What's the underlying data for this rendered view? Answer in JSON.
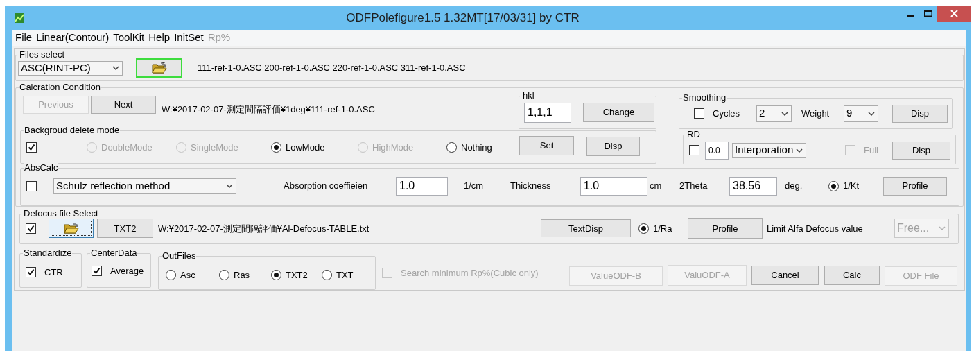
{
  "window": {
    "title": "ODFPolefigure1.5 1.32MT[17/03/31] by CTR"
  },
  "menu": [
    {
      "label": "File",
      "disabled": false
    },
    {
      "label": "Linear(Contour)",
      "disabled": false
    },
    {
      "label": "ToolKit",
      "disabled": false
    },
    {
      "label": "Help",
      "disabled": false
    },
    {
      "label": "InitSet",
      "disabled": false
    },
    {
      "label": "Rp%",
      "disabled": true
    }
  ],
  "files_select": {
    "title": "Files select",
    "items": [
      {
        "kind": "combo",
        "value": "ASC(RINT-PC)",
        "disabled": false
      },
      {
        "kind": "folder_button",
        "highlighted": true,
        "focused": false
      },
      {
        "kind": "text",
        "text": "111-ref-1-0.ASC 200-ref-1-0.ASC 220-ref-1-0.ASC 311-ref-1-0.ASC"
      }
    ]
  },
  "calc_condition": {
    "title": "Calcration Condition",
    "items": [
      {
        "kind": "button",
        "label": "Previous",
        "disabled": true
      },
      {
        "kind": "button",
        "label": "Next",
        "disabled": false
      },
      {
        "kind": "text",
        "text": "W:¥2017-02-07-測定間隔評価¥1deg¥111-ref-1-0.ASC"
      }
    ],
    "hkl": {
      "title": "hkl",
      "items": [
        {
          "kind": "field",
          "value": "1,1,1"
        },
        {
          "kind": "button",
          "label": "Change",
          "disabled": false
        }
      ]
    },
    "smoothing": {
      "title": "Smoothing",
      "items": [
        {
          "kind": "checkbox",
          "label": "Cycles",
          "checked": false,
          "disabled": false
        },
        {
          "kind": "combo",
          "value": "2",
          "disabled": false
        },
        {
          "kind": "text",
          "text": "Weight"
        },
        {
          "kind": "combo",
          "value": "9",
          "disabled": false
        },
        {
          "kind": "button",
          "label": "Disp",
          "disabled": false
        }
      ]
    },
    "background": {
      "title": "Backgroud delete mode",
      "items": [
        {
          "kind": "checkbox",
          "checked": true,
          "disabled": false
        },
        {
          "kind": "radio",
          "label": "DoubleMode",
          "selected": false,
          "disabled": true
        },
        {
          "kind": "radio",
          "label": "SingleMode",
          "selected": false,
          "disabled": true
        },
        {
          "kind": "radio",
          "label": "LowMode",
          "selected": true,
          "disabled": false
        },
        {
          "kind": "radio",
          "label": "HighMode",
          "selected": false,
          "disabled": true
        },
        {
          "kind": "radio",
          "label": "Nothing",
          "selected": false,
          "disabled": false
        },
        {
          "kind": "button",
          "label": "Set",
          "disabled": false
        },
        {
          "kind": "button",
          "label": "Disp",
          "disabled": false
        }
      ]
    },
    "rd": {
      "title": "RD",
      "items": [
        {
          "kind": "checkbox",
          "checked": false,
          "disabled": false
        },
        {
          "kind": "field",
          "value": "0.0"
        },
        {
          "kind": "combo",
          "value": "Interporation",
          "disabled": false
        },
        {
          "kind": "checkbox",
          "label": "Full",
          "checked": false,
          "disabled": true
        },
        {
          "kind": "button",
          "label": "Disp",
          "disabled": false
        }
      ]
    },
    "abs_calc": {
      "title": "AbsCalc",
      "items": [
        {
          "kind": "checkbox",
          "checked": false,
          "disabled": false
        },
        {
          "kind": "combo",
          "value": "Schulz reflection method",
          "disabled": false
        },
        {
          "kind": "text",
          "text": "Absorption coeffieien"
        },
        {
          "kind": "field",
          "value": "1.0"
        },
        {
          "kind": "text",
          "text": "1/cm"
        },
        {
          "kind": "text",
          "text": "Thickness"
        },
        {
          "kind": "field",
          "value": "1.0"
        },
        {
          "kind": "text",
          "text": "cm"
        },
        {
          "kind": "text",
          "text": "2Theta"
        },
        {
          "kind": "field",
          "value": "38.56"
        },
        {
          "kind": "text",
          "text": "deg."
        },
        {
          "kind": "radio",
          "label": "1/Kt",
          "selected": true,
          "disabled": false
        },
        {
          "kind": "button",
          "label": "Profile",
          "disabled": false
        }
      ]
    }
  },
  "defocus": {
    "title": "Defocus file Select",
    "items": [
      {
        "kind": "checkbox",
        "checked": true,
        "disabled": false
      },
      {
        "kind": "folder_button",
        "highlighted": false,
        "focused": true
      },
      {
        "kind": "button",
        "label": "TXT2",
        "disabled": false
      },
      {
        "kind": "text",
        "text": "W:¥2017-02-07-測定間隔評価¥Al-Defocus-TABLE.txt"
      },
      {
        "kind": "button",
        "label": "TextDisp",
        "disabled": false
      },
      {
        "kind": "radio",
        "label": "1/Ra",
        "selected": true,
        "disabled": false
      },
      {
        "kind": "button",
        "label": "Profile",
        "disabled": false
      },
      {
        "kind": "text",
        "text": "Limit Alfa Defocus value"
      },
      {
        "kind": "combo",
        "value": "Free...",
        "disabled": true
      }
    ]
  },
  "standardize": {
    "title": "Standardize",
    "items": [
      {
        "kind": "checkbox",
        "label": "CTR",
        "checked": true,
        "disabled": false
      }
    ]
  },
  "center_data": {
    "title": "CenterData",
    "items": [
      {
        "kind": "checkbox",
        "label": "Average",
        "checked": true,
        "disabled": false
      }
    ]
  },
  "out_files": {
    "title": "OutFiles",
    "items": [
      {
        "kind": "radio",
        "label": "Asc",
        "selected": false,
        "disabled": false
      },
      {
        "kind": "radio",
        "label": "Ras",
        "selected": false,
        "disabled": false
      },
      {
        "kind": "radio",
        "label": "TXT2",
        "selected": true,
        "disabled": false
      },
      {
        "kind": "radio",
        "label": "TXT",
        "selected": false,
        "disabled": false
      }
    ]
  },
  "bottom_items": [
    {
      "kind": "checkbox",
      "label": "Search minimum Rp%(Cubic only)",
      "checked": false,
      "disabled": true
    },
    {
      "kind": "button",
      "label": "ValueODF-B",
      "disabled": true
    },
    {
      "kind": "button",
      "label": "ValuODF-A",
      "disabled": true
    },
    {
      "kind": "button",
      "label": "Cancel",
      "disabled": false
    },
    {
      "kind": "button",
      "label": "Calc",
      "disabled": false
    },
    {
      "kind": "button",
      "label": "ODF File",
      "disabled": true
    }
  ]
}
